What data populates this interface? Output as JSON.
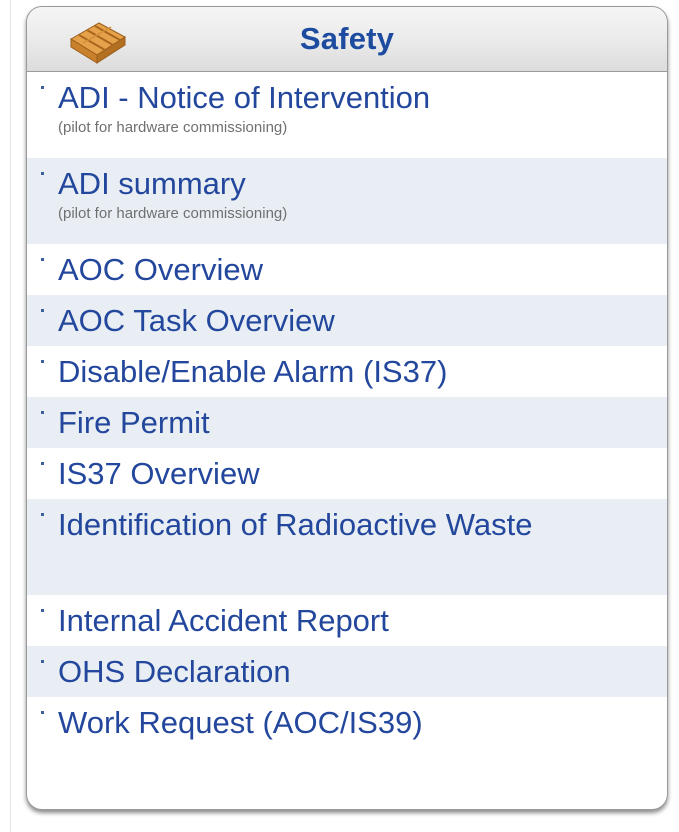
{
  "panel": {
    "title": "Safety",
    "icon": "crate-icon"
  },
  "items": [
    {
      "label": "ADI - Notice of Intervention",
      "sub": "(pilot for hardware commissioning)"
    },
    {
      "label": "ADI summary",
      "sub": "(pilot for hardware commissioning)"
    },
    {
      "label": "AOC Overview"
    },
    {
      "label": "AOC Task Overview"
    },
    {
      "label": "Disable/Enable Alarm (IS37)"
    },
    {
      "label": "Fire Permit"
    },
    {
      "label": "IS37 Overview"
    },
    {
      "label": "Identification of Radioactive Waste"
    },
    {
      "label": "Internal Accident Report"
    },
    {
      "label": "OHS Declaration"
    },
    {
      "label": "Work Request (AOC/IS39)"
    }
  ],
  "colors": {
    "link": "#23479c",
    "title": "#1d4ba0",
    "row_shade": "#e9eef5"
  }
}
